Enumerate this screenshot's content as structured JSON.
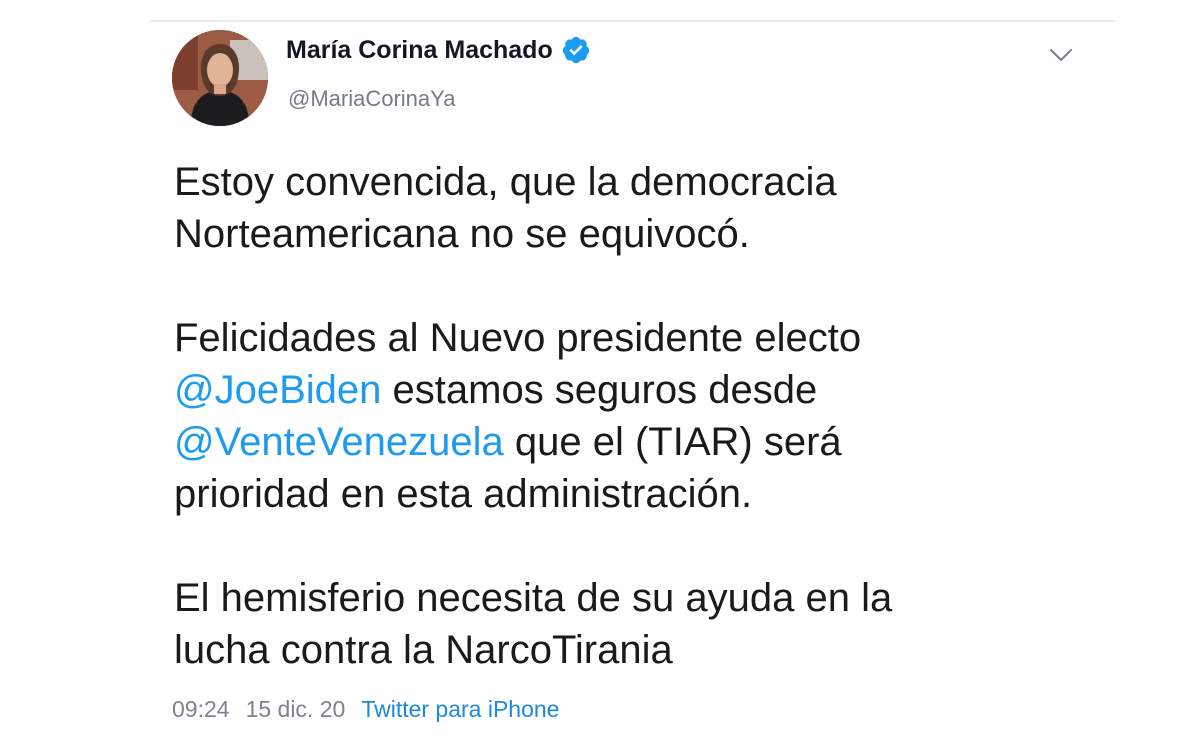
{
  "author": {
    "display_name": "María Corina Machado",
    "handle": "@MariaCorinaYa",
    "verified": true
  },
  "icons": {
    "verified": "verified-badge-icon",
    "menu": "chevron-down-icon"
  },
  "tweet": {
    "paragraph1": {
      "line1": "Estoy convencida, que la democracia",
      "line2": "Norteamericana no se equivocó."
    },
    "paragraph2": {
      "line1": "Felicidades al Nuevo presidente electo",
      "mention1": "@JoeBiden",
      "line2_rest": " estamos seguros desde",
      "mention2": "@VenteVenezuela",
      "line3_rest": " que el (TIAR) será",
      "line4": "prioridad en esta administración."
    },
    "paragraph3": {
      "line1": "El hemisferio necesita de su ayuda en la",
      "line2": "lucha contra la NarcoTirania"
    }
  },
  "meta": {
    "time": "09:24",
    "date": "15 dic. 20",
    "source": "Twitter para iPhone"
  },
  "colors": {
    "mention": "#1d9bf0",
    "verified": "#1d9bf0",
    "muted_text": "#7b848d"
  }
}
